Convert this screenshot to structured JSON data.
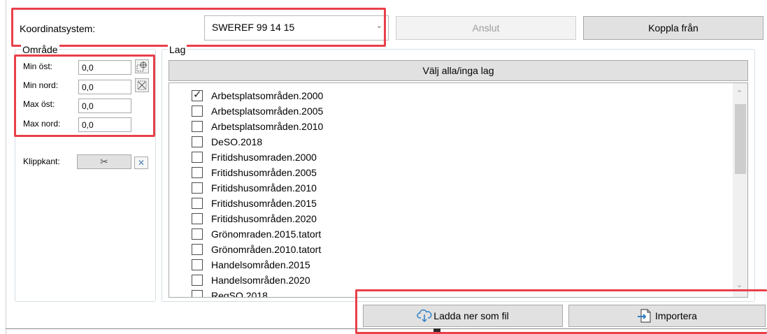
{
  "top": {
    "coord_label": "Koordinatsystem:",
    "coord_value": "SWEREF 99 14 15",
    "connect_label": "Anslut",
    "disconnect_label": "Koppla från"
  },
  "area": {
    "title": "Område",
    "min_east_label": "Min öst:",
    "min_east_value": "0,0",
    "min_north_label": "Min nord:",
    "min_north_value": "0,0",
    "max_east_label": "Max öst:",
    "max_east_value": "0,0",
    "max_north_label": "Max nord:",
    "max_north_value": "0,0",
    "clip_label": "Klippkant:"
  },
  "layers": {
    "title": "Lag",
    "select_all_label": "Välj alla/inga lag",
    "items": [
      {
        "label": "Arbetsplatsområden.2000",
        "checked": true
      },
      {
        "label": "Arbetsplatsområden.2005",
        "checked": false
      },
      {
        "label": "Arbetsplatsområden.2010",
        "checked": false
      },
      {
        "label": "DeSO.2018",
        "checked": false
      },
      {
        "label": "Fritidshusomraden.2000",
        "checked": false
      },
      {
        "label": "Fritidshusområden.2005",
        "checked": false
      },
      {
        "label": "Fritidshusområden.2010",
        "checked": false
      },
      {
        "label": "Fritidshusområden.2015",
        "checked": false
      },
      {
        "label": "Fritidshusområden.2020",
        "checked": false
      },
      {
        "label": "Grönomraden.2015.tatort",
        "checked": false
      },
      {
        "label": "Grönområden.2010.tatort",
        "checked": false
      },
      {
        "label": "Handelsområden.2015",
        "checked": false
      },
      {
        "label": "Handelsområden.2020",
        "checked": false
      },
      {
        "label": "RegSO.2018",
        "checked": false
      }
    ]
  },
  "bottom": {
    "download_label": "Ladda ner som fil",
    "import_label": "Importera"
  },
  "icons": {
    "highlight_color": "#e8404a",
    "download": "cloud-download-icon",
    "import": "import-icon",
    "clip": "scissors-icon",
    "clear": "clear-x-icon"
  }
}
